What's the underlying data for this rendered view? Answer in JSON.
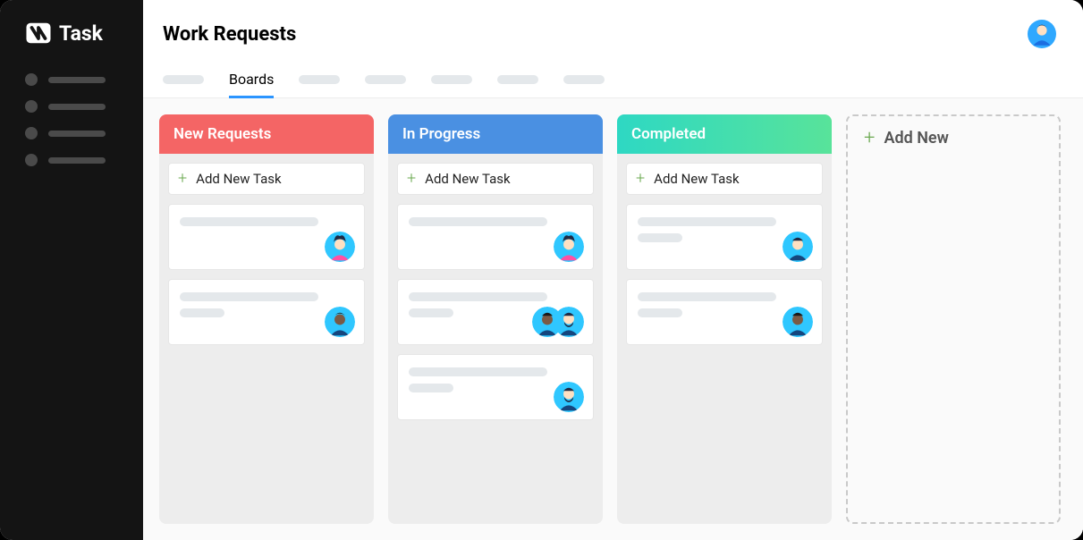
{
  "app_name": "Task",
  "header": {
    "title": "Work Requests"
  },
  "tabs": {
    "active_label": "Boards"
  },
  "columns": [
    {
      "id": "new_requests",
      "title": "New Requests",
      "add_label": "Add New Task"
    },
    {
      "id": "in_progress",
      "title": "In Progress",
      "add_label": "Add New Task"
    },
    {
      "id": "completed",
      "title": "Completed",
      "add_label": "Add New Task"
    }
  ],
  "add_column_label": "Add New",
  "avatars": {
    "pink_hair": "avatar-pink",
    "dark_male": "avatar-dark",
    "beard_male": "avatar-beard",
    "light_male": "avatar-light"
  }
}
